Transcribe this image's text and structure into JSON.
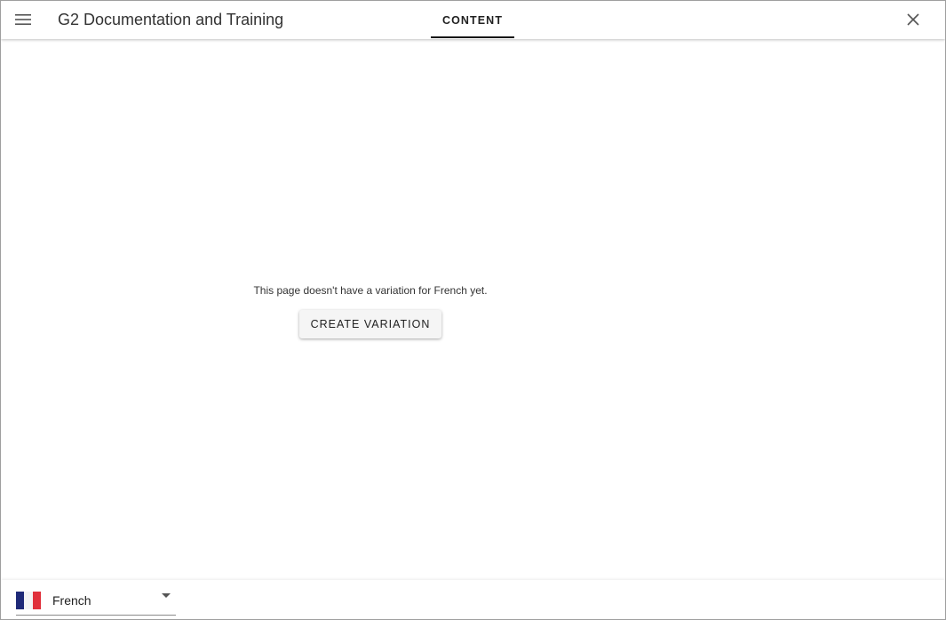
{
  "header": {
    "menu_icon": "hamburger-menu-icon",
    "title": "G2 Documentation and Training",
    "tabs": [
      {
        "label": "CONTENT",
        "active": true
      }
    ],
    "close_icon": "close-icon"
  },
  "main": {
    "message": "This page doesn't have a variation for French yet.",
    "create_button_label": "CREATE VARIATION"
  },
  "footer": {
    "language": {
      "selected": "French",
      "flag_icon": "french-flag-icon",
      "flag_colors": [
        "#1a237e",
        "#ffffff",
        "#e53935"
      ],
      "caret_icon": "dropdown-caret-icon"
    }
  },
  "colors": {
    "tab_indicator": "#111111",
    "button_bg": "#f5f5f5",
    "text_primary": "#212121"
  }
}
